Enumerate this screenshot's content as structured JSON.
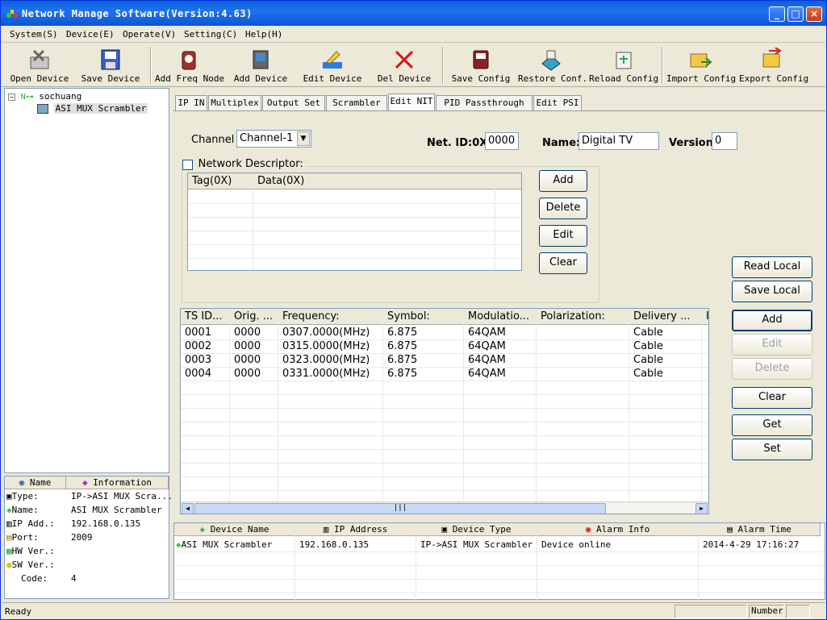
{
  "window": {
    "title": "Network Manage Software(Version:4.63)"
  },
  "menu": [
    "System(S)",
    "Device(E)",
    "Operate(V)",
    "Setting(C)",
    "Help(H)"
  ],
  "toolbar": [
    "Open Device",
    "Save Device",
    "Add Freq Node",
    "Add Device",
    "Edit Device",
    "Del Device",
    "Save Config",
    "Restore Conf.",
    "Reload Config",
    "Import Config",
    "Export Config"
  ],
  "tree": {
    "root": "sochuang",
    "child": "ASI MUX Scrambler"
  },
  "info": {
    "headers": [
      "Name",
      "Information"
    ],
    "rows": [
      {
        "name": "Type:",
        "value": "IP->ASI MUX Scra..."
      },
      {
        "name": "Name:",
        "value": "ASI MUX Scrambler"
      },
      {
        "name": "IP Add.:",
        "value": "192.168.0.135"
      },
      {
        "name": "Port:",
        "value": "2009"
      },
      {
        "name": "HW Ver.:",
        "value": ""
      },
      {
        "name": "SW Ver.:",
        "value": ""
      },
      {
        "name": "Code:",
        "value": "4"
      }
    ]
  },
  "tabs": [
    "IP IN",
    "Multiplex",
    "Output Set",
    "Scrambler",
    "Edit NIT",
    "PID Passthrough",
    "Edit PSI"
  ],
  "active_tab": "Edit NIT",
  "form": {
    "channel_label": "Channel",
    "channel_value": "Channel-1",
    "netid_label": "Net. ID:0X",
    "netid_value": "0000",
    "name_label": "Name:",
    "name_value": "Digital TV",
    "version_label": "Version",
    "version_value": "0",
    "netdesc_label": "Network Descriptor:"
  },
  "desc_grid": {
    "headers": [
      "Tag(0X)",
      "Data(0X)"
    ]
  },
  "desc_buttons": [
    "Add",
    "Delete",
    "Edit",
    "Clear"
  ],
  "ts_grid": {
    "headers": [
      "TS ID...",
      "Orig. ...",
      "Frequency:",
      "Symbol:",
      "Modulatio...",
      "Polarization:",
      "Delivery ...",
      "I"
    ],
    "rows": [
      [
        "0001",
        "0000",
        "0307.0000(MHz)",
        "6.875",
        "64QAM",
        "",
        "Cable"
      ],
      [
        "0002",
        "0000",
        "0315.0000(MHz)",
        "6.875",
        "64QAM",
        "",
        "Cable"
      ],
      [
        "0003",
        "0000",
        "0323.0000(MHz)",
        "6.875",
        "64QAM",
        "",
        "Cable"
      ],
      [
        "0004",
        "0000",
        "0331.0000(MHz)",
        "6.875",
        "64QAM",
        "",
        "Cable"
      ]
    ]
  },
  "right_buttons": {
    "read_local": "Read Local",
    "save_local": "Save Local",
    "add": "Add",
    "edit": "Edit",
    "delete": "Delete",
    "clear": "Clear",
    "get": "Get",
    "set": "Set"
  },
  "alarm": {
    "headers": [
      "Device Name",
      "IP Address",
      "Device Type",
      "Alarm Info",
      "Alarm Time"
    ],
    "rows": [
      [
        "ASI MUX Scrambler",
        "192.168.0.135",
        "IP->ASI MUX Scrambler",
        "Device online",
        "2014-4-29 17:16:27"
      ]
    ]
  },
  "status": {
    "text": "Ready",
    "number_label": "Number"
  },
  "colors": {
    "titlebar": "#0a5fd8",
    "window_bg": "#ece9d8",
    "border": "#7f9db9"
  }
}
